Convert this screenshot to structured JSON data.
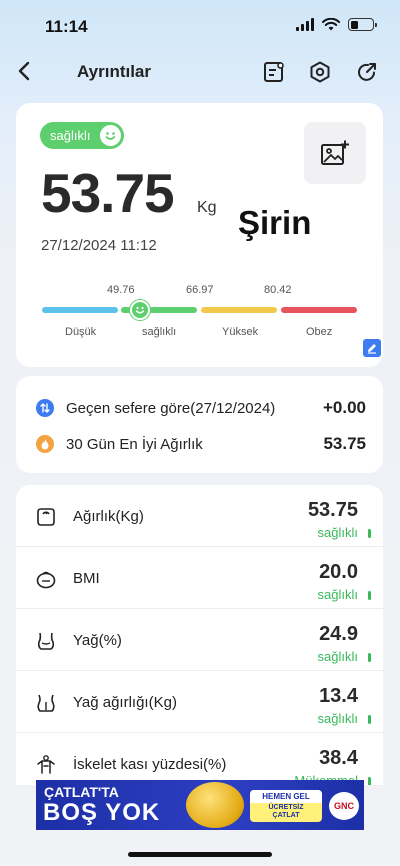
{
  "status_bar": {
    "time": "11:14"
  },
  "nav": {
    "title": "Ayrıntılar"
  },
  "summary": {
    "status_badge": "sağlıklı",
    "weight": "53.75",
    "unit": "Kg",
    "name": "Şirin",
    "timestamp": "27/12/2024 11:12"
  },
  "scale": {
    "thresholds": [
      "49.76",
      "66.97",
      "80.42"
    ],
    "labels": [
      "Düşük",
      "sağlıklı",
      "Yüksek",
      "Obez"
    ],
    "colors": [
      "#5bc3ea",
      "#5dcf6e",
      "#f2c94c",
      "#e8545e"
    ],
    "current_value": 53.75
  },
  "comparison": {
    "rows": [
      {
        "label": "Geçen sefere göre(27/12/2024)",
        "value": "+0.00",
        "icon": "compare-arrows-icon",
        "color": "#3c7bf0"
      },
      {
        "label": "30 Gün En İyi Ağırlık",
        "value": "53.75",
        "icon": "flame-icon",
        "color": "#f4a340"
      }
    ]
  },
  "metrics": [
    {
      "label": "Ağırlık(Kg)",
      "value": "53.75",
      "status": "sağlıklı",
      "icon": "scale-icon"
    },
    {
      "label": "BMI",
      "value": "20.0",
      "status": "sağlıklı",
      "icon": "bmi-icon"
    },
    {
      "label": "Yağ(%)",
      "value": "24.9",
      "status": "sağlıklı",
      "icon": "body-fat-icon"
    },
    {
      "label": "Yağ ağırlığı(Kg)",
      "value": "13.4",
      "status": "sağlıklı",
      "icon": "fat-weight-icon"
    },
    {
      "label": "İskelet kası yüzdesi(%)",
      "value": "38.4",
      "status": "Mükemmel",
      "icon": "muscle-icon"
    }
  ],
  "ad": {
    "line1": "ÇATLAT'TA",
    "line2": "BOŞ YOK",
    "cta_top": "HEMEN GEL",
    "cta_line1": "ÜCRETSİZ",
    "cta_line2": "ÇATLAT",
    "brand": "GNC"
  },
  "colors": {
    "accent_green": "#5dcf6e",
    "status_green": "#38b95a",
    "edit_blue": "#3c7bf0"
  }
}
